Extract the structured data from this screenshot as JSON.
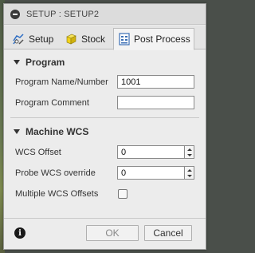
{
  "window": {
    "title": "SETUP : SETUP2"
  },
  "tabs": [
    {
      "label": "Setup",
      "icon": "setup-icon",
      "active": false
    },
    {
      "label": "Stock",
      "icon": "stock-cube-icon",
      "active": false
    },
    {
      "label": "Post Process",
      "icon": "post-process-icon",
      "active": true
    }
  ],
  "program": {
    "header": "Program",
    "name_label": "Program Name/Number",
    "name_value": "1001",
    "comment_label": "Program Comment",
    "comment_value": ""
  },
  "machine_wcs": {
    "header": "Machine WCS",
    "wcs_offset_label": "WCS Offset",
    "wcs_offset_value": "0",
    "probe_label": "Probe WCS override",
    "probe_value": "0",
    "multiple_label": "Multiple WCS Offsets",
    "multiple_checked": false
  },
  "footer": {
    "ok_label": "OK",
    "cancel_label": "Cancel"
  },
  "colors": {
    "stock_cube": "#f2d21a",
    "post_process_icon": "#3b6fb5"
  }
}
